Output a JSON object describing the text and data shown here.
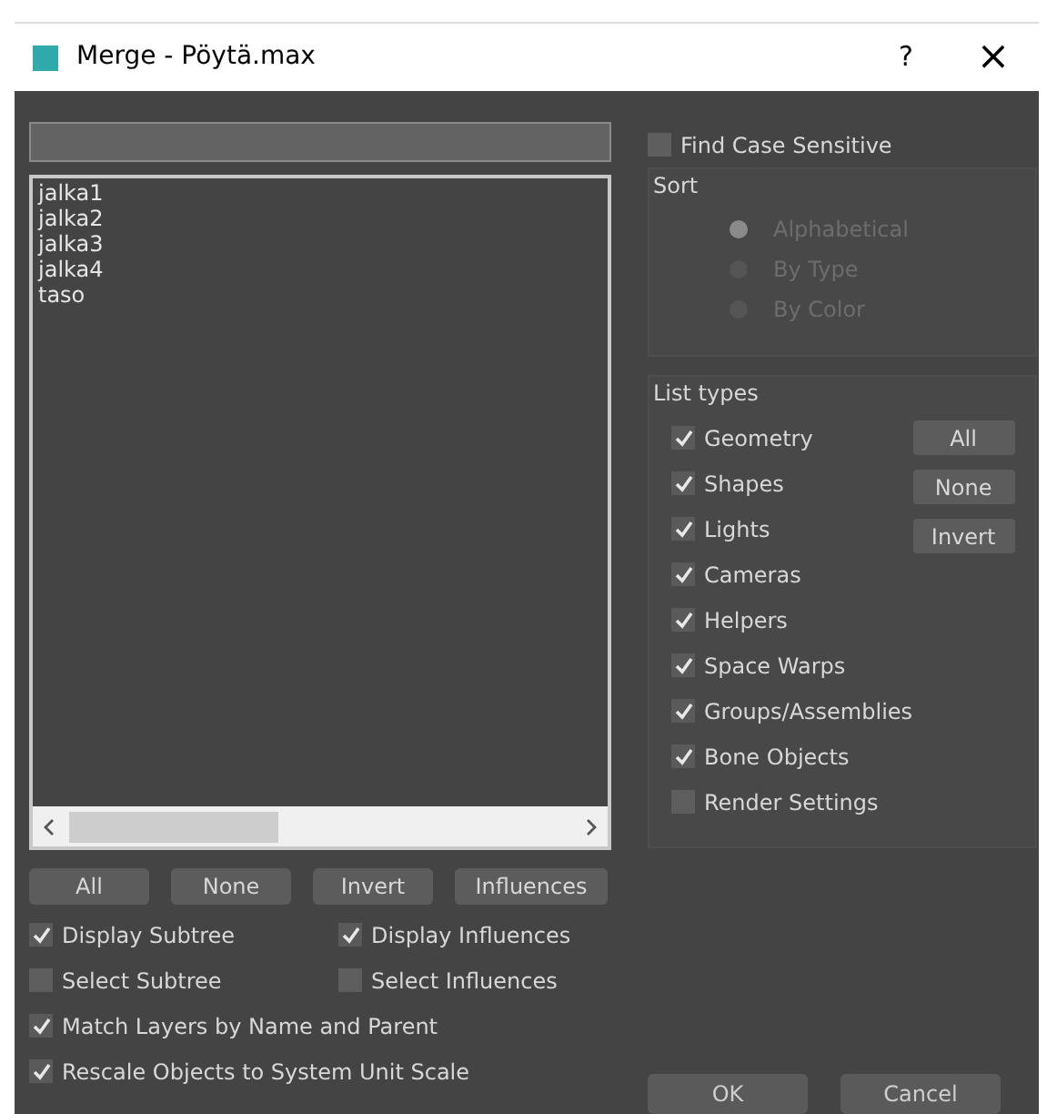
{
  "window": {
    "title": "Merge - Pöytä.max",
    "help": "?",
    "close": "×"
  },
  "objects": [
    {
      "name": "jalka1",
      "selected": false
    },
    {
      "name": "jalka2",
      "selected": false
    },
    {
      "name": "jalka3",
      "selected": false
    },
    {
      "name": "jalka4",
      "selected": false
    },
    {
      "name": "taso",
      "selected": false
    }
  ],
  "list_buttons": [
    "All",
    "None",
    "Invert",
    "Influences"
  ],
  "options": [
    {
      "label": "Display Subtree",
      "checked": true
    },
    {
      "label": "Display Influences",
      "checked": true
    },
    {
      "label": "Select Subtree",
      "checked": false
    },
    {
      "label": "Select Influences",
      "checked": false
    },
    {
      "label": "Match Layers by Name and Parent",
      "checked": true
    },
    {
      "label": "Rescale Objects to System Unit Scale",
      "checked": true
    }
  ],
  "find_case_sensitive": {
    "label": "Find Case Sensitive",
    "checked": false
  },
  "sort": {
    "title": "Sort",
    "disabled": true,
    "options": [
      {
        "label": "Alphabetical",
        "selected": true
      },
      {
        "label": "By Type",
        "selected": false
      },
      {
        "label": "By Color",
        "selected": false
      }
    ]
  },
  "list_types": {
    "title": "List types",
    "types": [
      {
        "label": "Geometry",
        "checked": true
      },
      {
        "label": "Shapes",
        "checked": true
      },
      {
        "label": "Lights",
        "checked": true
      },
      {
        "label": "Cameras",
        "checked": true
      },
      {
        "label": "Helpers",
        "checked": true
      },
      {
        "label": "Space Warps",
        "checked": true
      },
      {
        "label": "Groups/Assemblies",
        "checked": true
      },
      {
        "label": "Bone Objects",
        "checked": true
      },
      {
        "label": "Render Settings",
        "checked": false
      }
    ],
    "buttons": [
      "All",
      "None",
      "Invert"
    ]
  },
  "dialog_buttons": [
    "OK",
    "Cancel"
  ]
}
